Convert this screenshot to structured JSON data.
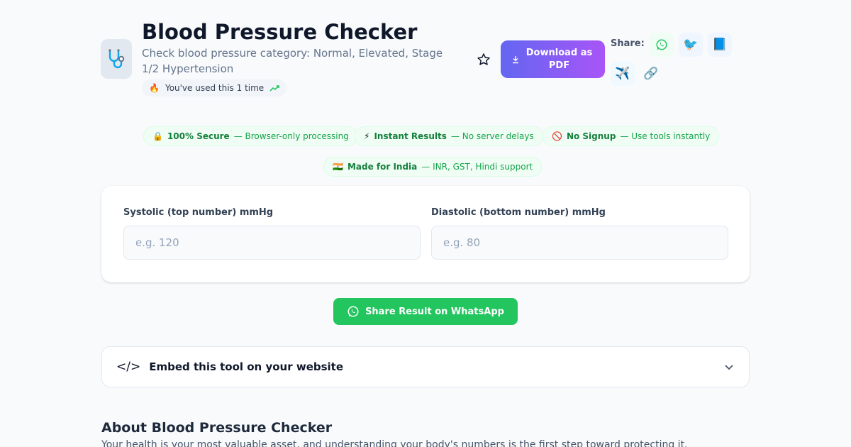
{
  "header": {
    "title": "Blood Pressure Checker",
    "subtitle": "Check blood pressure category: Normal, Elevated, Stage 1/2 Hypertension",
    "usage": "You've used this 1 time",
    "download_label": "Download as PDF",
    "share_label": "Share:"
  },
  "share_icons": [
    "whatsapp-icon",
    "twitter-icon",
    "facebook-icon",
    "telegram-icon",
    "link-icon"
  ],
  "badges": [
    {
      "title": "100% Secure",
      "desc": "— Browser-only processing",
      "icon": "lock-icon"
    },
    {
      "title": "Instant Results",
      "desc": "— No server delays",
      "icon": "lightning-icon"
    },
    {
      "title": "No Signup",
      "desc": "— Use tools instantly",
      "icon": "no-entry-icon"
    },
    {
      "title": "Made for India",
      "desc": "— INR, GST, Hindi support",
      "icon": "india-flag-icon"
    }
  ],
  "form": {
    "systolic_label": "Systolic (top number) mmHg",
    "systolic_placeholder": "e.g. 120",
    "diastolic_label": "Diastolic (bottom number) mmHg",
    "diastolic_placeholder": "e.g. 80"
  },
  "whatsapp_button": "Share Result on WhatsApp",
  "embed": {
    "label": "Embed this tool on your website"
  },
  "about": {
    "title": "About Blood Pressure Checker",
    "text": "Your health is your most valuable asset, and understanding your body's numbers is the first step toward protecting it."
  },
  "colors": {
    "accent_gradient_start": "#6366f1",
    "accent_gradient_end": "#a855f7",
    "whatsapp": "#22c55e",
    "badge_green": "#16a34a"
  }
}
